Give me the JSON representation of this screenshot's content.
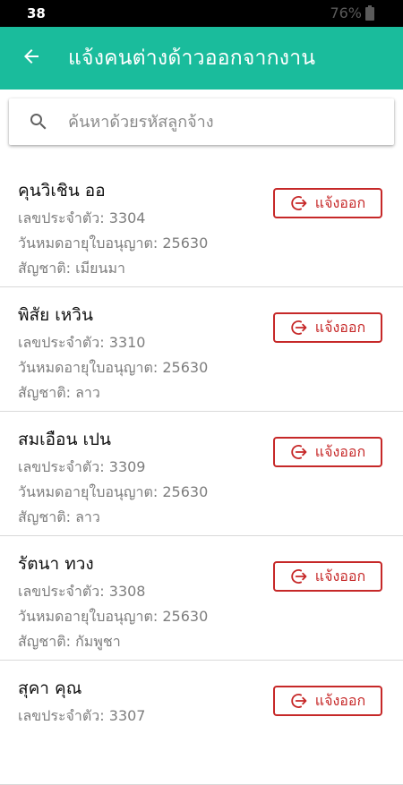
{
  "status_bar": {
    "time": "38",
    "battery_percent": "76%"
  },
  "app_bar": {
    "title": "แจ้งคนต่างด้าวออกจากงาน",
    "background": "#1abc9c"
  },
  "search": {
    "placeholder": "ค้นหาด้วยรหัสลูกจ้าง",
    "value": ""
  },
  "workers": [
    {
      "name": "คุนวิเชิน ออ",
      "id_line": "เลขประจำตัว: 3304",
      "expiry_line": "วันหมดอายุใบอนุญาต: 25630",
      "nationality_line": "สัญชาติ: เมียนมา",
      "action": "แจ้งออก"
    },
    {
      "name": "พิสัย เหวิน",
      "id_line": "เลขประจำตัว: 3310",
      "expiry_line": "วันหมดอายุใบอนุญาต: 25630",
      "nationality_line": "สัญชาติ: ลาว",
      "action": "แจ้งออก"
    },
    {
      "name": "สมเอือน เปน",
      "id_line": "เลขประจำตัว: 3309",
      "expiry_line": "วันหมดอายุใบอนุญาต: 25630",
      "nationality_line": "สัญชาติ: ลาว",
      "action": "แจ้งออก"
    },
    {
      "name": "รัตนา ทวง",
      "id_line": "เลขประจำตัว: 3308",
      "expiry_line": "วันหมดอายุใบอนุญาต: 25630",
      "nationality_line": "สัญชาติ: กัมพูชา",
      "action": "แจ้งออก"
    },
    {
      "name": "สุคา คุณ",
      "id_line": "เลขประจำตัว: 3307",
      "expiry_line": "",
      "nationality_line": "",
      "action": "แจ้งออก"
    }
  ],
  "colors": {
    "accent": "#1abc9c",
    "danger": "#c62828"
  },
  "icons": {
    "back": "arrow-left-icon",
    "search": "search-icon",
    "exit": "exit-circle-arrow-icon",
    "battery": "battery-icon"
  }
}
